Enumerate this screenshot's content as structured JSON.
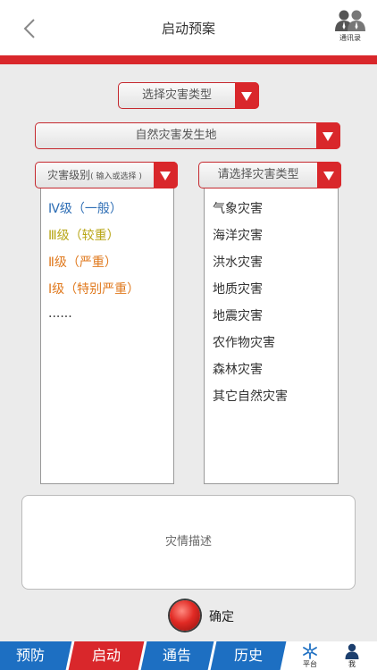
{
  "header": {
    "title": "启动预案",
    "contacts_label": "通讯录"
  },
  "selectors": {
    "disaster_type": "选择灾害类型",
    "location": "自然灾害发生地",
    "level_label": "灾害级别",
    "level_hint": "( 输入或选择 )",
    "category_placeholder": "请选择灾害类型"
  },
  "levels": [
    {
      "label": "Ⅳ级（一般）",
      "color": "#2e6eb5"
    },
    {
      "label": "Ⅲ级（较重）",
      "color": "#b8a616"
    },
    {
      "label": "Ⅱ级（严重）",
      "color": "#e07a1f"
    },
    {
      "label": "Ⅰ级（特别严重）",
      "color": "#e07a1f"
    },
    {
      "label": "......",
      "color": "#333333"
    }
  ],
  "categories": [
    "气象灾害",
    "海洋灾害",
    "洪水灾害",
    "地质灾害",
    "地震灾害",
    "农作物灾害",
    "森林灾害",
    "其它自然灾害"
  ],
  "description_placeholder": "灾情描述",
  "confirm_label": "确定",
  "tabs": [
    {
      "label": "预防",
      "color": "#1d6fc2"
    },
    {
      "label": "启动",
      "color": "#d9272b"
    },
    {
      "label": "通告",
      "color": "#1d6fc2"
    },
    {
      "label": "历史",
      "color": "#1d6fc2"
    }
  ],
  "tab_icons": {
    "platform_label": "平台",
    "me_label": "我"
  },
  "colors": {
    "accent_red": "#d9272b",
    "accent_blue": "#1d6fc2"
  }
}
